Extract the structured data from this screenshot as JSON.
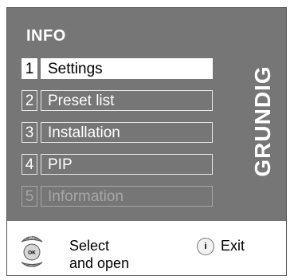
{
  "menu": {
    "title": "INFO",
    "brand": "GRUNDIG",
    "items": [
      {
        "num": "1",
        "label": "Settings",
        "state": "selected"
      },
      {
        "num": "2",
        "label": "Preset list",
        "state": "normal"
      },
      {
        "num": "3",
        "label": "Installation",
        "state": "normal"
      },
      {
        "num": "4",
        "label": "PIP",
        "state": "normal"
      },
      {
        "num": "5",
        "label": "Information",
        "state": "disabled"
      }
    ]
  },
  "footer": {
    "dial": {
      "up": "P+",
      "center": "OK",
      "down": "P-"
    },
    "select_line1": "Select",
    "select_line2": "and open",
    "info_icon": "i",
    "exit_label": "Exit"
  },
  "colors": {
    "panel": "#767676",
    "selected_bg": "#ffffff",
    "text": "#ffffff",
    "disabled": "#a6a6a6"
  }
}
